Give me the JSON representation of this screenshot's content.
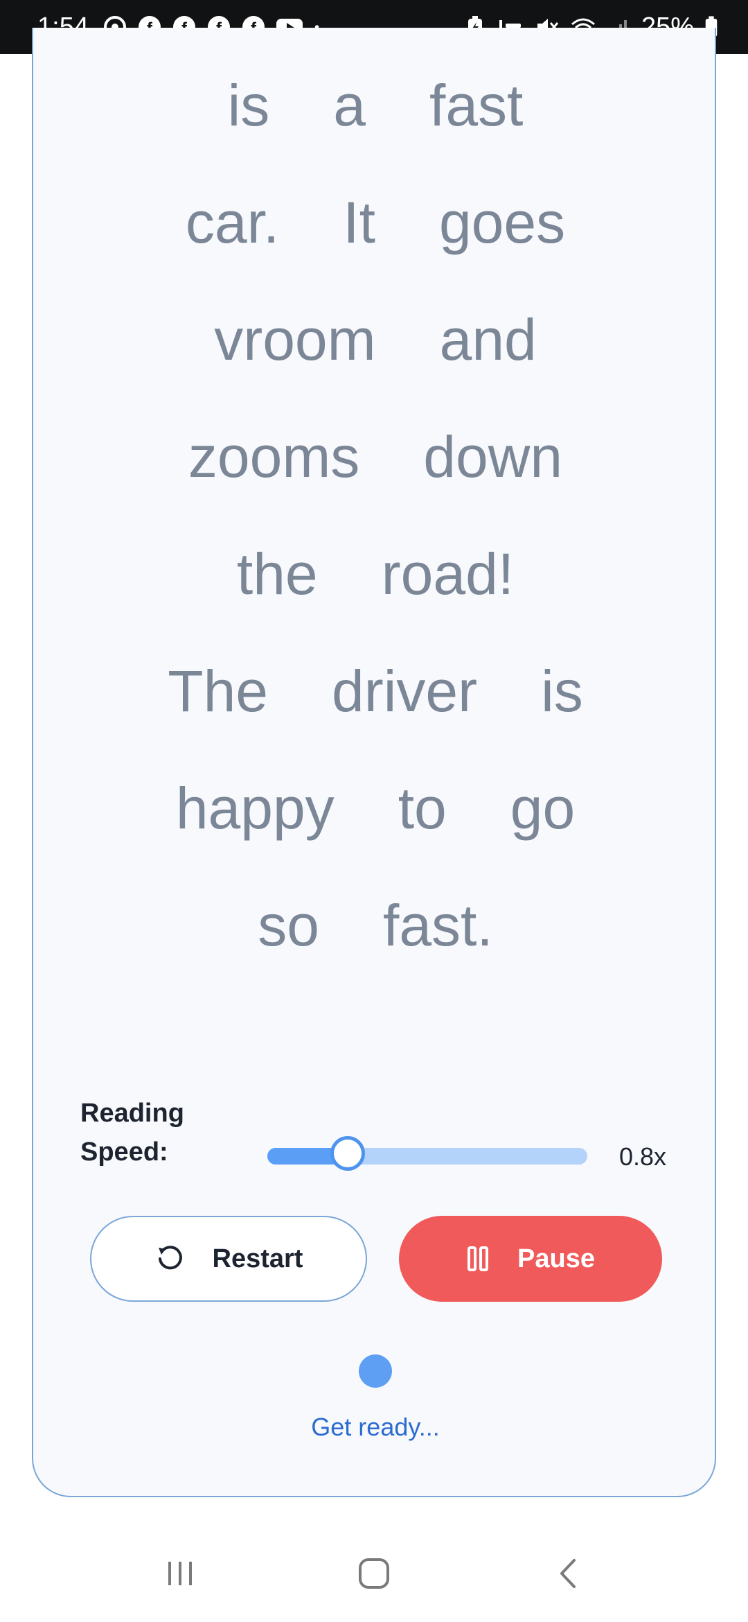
{
  "status_bar": {
    "time": "1:54",
    "battery": "25%",
    "left_icons": [
      "chrome-icon",
      "facebook-icon",
      "facebook-icon",
      "facebook-icon",
      "facebook-icon",
      "youtube-icon",
      "dot-icon"
    ],
    "right_icons": [
      "battery-saver-icon",
      "bed-icon",
      "mute-icon",
      "wifi-icon",
      "signal-icon",
      "battery-icon"
    ]
  },
  "reader": {
    "lines": [
      [
        "is",
        "a",
        "fast"
      ],
      [
        "car.",
        "It",
        "goes"
      ],
      [
        "vroom",
        "and"
      ],
      [
        "zooms",
        "down"
      ],
      [
        "the",
        "road!"
      ],
      [
        "The",
        "driver",
        "is"
      ],
      [
        "happy",
        "to",
        "go"
      ],
      [
        "so",
        "fast."
      ]
    ]
  },
  "controls": {
    "speed_label": "Reading Speed:",
    "speed_value": "0.8x",
    "speed_fraction": 0.25,
    "restart_label": "Restart",
    "pause_label": "Pause"
  },
  "status": {
    "message": "Get ready..."
  },
  "colors": {
    "accent": "#5a9ef5",
    "pause": "#f05a5a",
    "word": "#7b8696",
    "status_text": "#2c6bd0"
  }
}
